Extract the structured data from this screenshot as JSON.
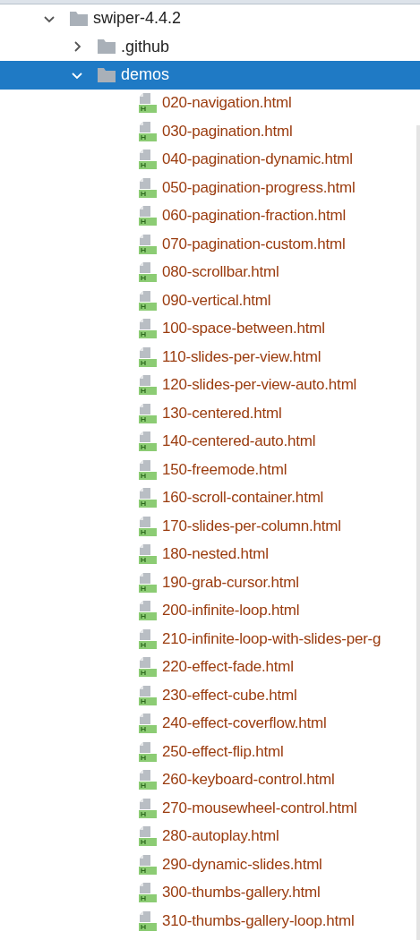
{
  "tree": [
    {
      "label": "swiper-4.4.2",
      "kind": "folder",
      "expanded": true,
      "selected": false,
      "children": [
        {
          "label": ".github",
          "kind": "folder",
          "expanded": false,
          "selected": false
        },
        {
          "label": "demos",
          "kind": "folder",
          "expanded": true,
          "selected": true,
          "children": [
            {
              "label": "020-navigation.html",
              "kind": "html",
              "selected": false
            },
            {
              "label": "030-pagination.html",
              "kind": "html",
              "selected": false
            },
            {
              "label": "040-pagination-dynamic.html",
              "kind": "html",
              "selected": false
            },
            {
              "label": "050-pagination-progress.html",
              "kind": "html",
              "selected": false
            },
            {
              "label": "060-pagination-fraction.html",
              "kind": "html",
              "selected": false
            },
            {
              "label": "070-pagination-custom.html",
              "kind": "html",
              "selected": false
            },
            {
              "label": "080-scrollbar.html",
              "kind": "html",
              "selected": false
            },
            {
              "label": "090-vertical.html",
              "kind": "html",
              "selected": false
            },
            {
              "label": "100-space-between.html",
              "kind": "html",
              "selected": false
            },
            {
              "label": "110-slides-per-view.html",
              "kind": "html",
              "selected": false
            },
            {
              "label": "120-slides-per-view-auto.html",
              "kind": "html",
              "selected": false
            },
            {
              "label": "130-centered.html",
              "kind": "html",
              "selected": false
            },
            {
              "label": "140-centered-auto.html",
              "kind": "html",
              "selected": false
            },
            {
              "label": "150-freemode.html",
              "kind": "html",
              "selected": false
            },
            {
              "label": "160-scroll-container.html",
              "kind": "html",
              "selected": false
            },
            {
              "label": "170-slides-per-column.html",
              "kind": "html",
              "selected": false
            },
            {
              "label": "180-nested.html",
              "kind": "html",
              "selected": false
            },
            {
              "label": "190-grab-cursor.html",
              "kind": "html",
              "selected": false
            },
            {
              "label": "200-infinite-loop.html",
              "kind": "html",
              "selected": false
            },
            {
              "label": "210-infinite-loop-with-slides-per-g",
              "kind": "html",
              "selected": false
            },
            {
              "label": "220-effect-fade.html",
              "kind": "html",
              "selected": false
            },
            {
              "label": "230-effect-cube.html",
              "kind": "html",
              "selected": false
            },
            {
              "label": "240-effect-coverflow.html",
              "kind": "html",
              "selected": false
            },
            {
              "label": "250-effect-flip.html",
              "kind": "html",
              "selected": false
            },
            {
              "label": "260-keyboard-control.html",
              "kind": "html",
              "selected": false
            },
            {
              "label": "270-mousewheel-control.html",
              "kind": "html",
              "selected": false
            },
            {
              "label": "280-autoplay.html",
              "kind": "html",
              "selected": false
            },
            {
              "label": "290-dynamic-slides.html",
              "kind": "html",
              "selected": false
            },
            {
              "label": "300-thumbs-gallery.html",
              "kind": "html",
              "selected": false
            },
            {
              "label": "310-thumbs-gallery-loop.html",
              "kind": "html",
              "selected": false
            }
          ]
        }
      ]
    }
  ]
}
